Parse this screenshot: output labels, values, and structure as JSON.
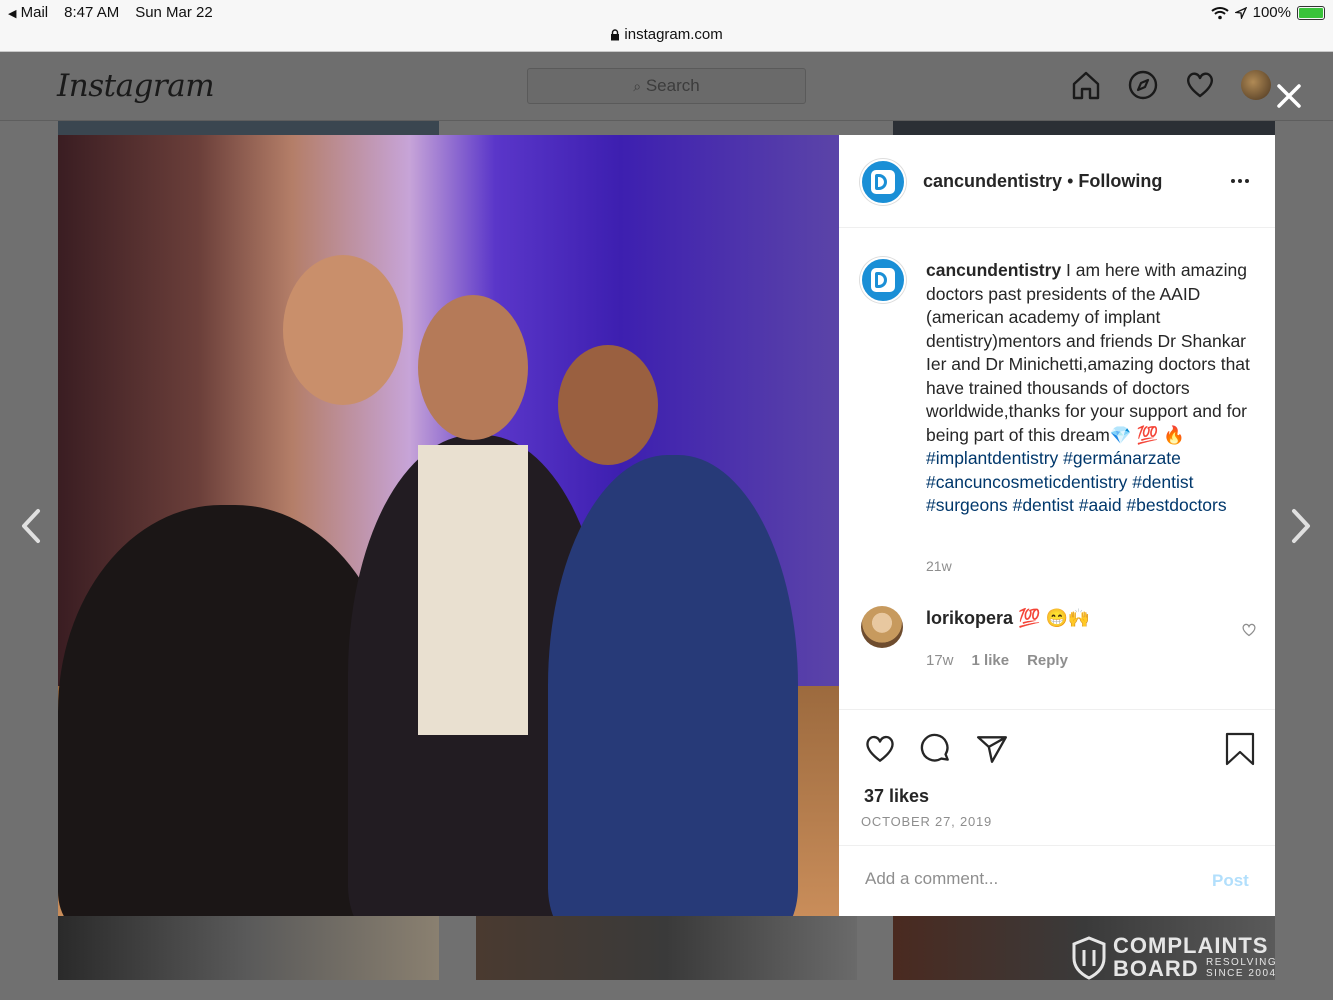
{
  "status_bar": {
    "back_app": "Mail",
    "time": "8:47 AM",
    "date": "Sun Mar 22",
    "battery": "100%"
  },
  "url": "instagram.com",
  "header": {
    "logo": "Instagram",
    "search_placeholder": "Search"
  },
  "post": {
    "username": "cancundentistry",
    "follow_status": "Following",
    "caption_user": "cancundentistry",
    "caption_text": " I am here with amazing doctors past presidents of the AAID (american academy of implant dentistry)mentors and friends Dr Shankar Ier and Dr Minichetti,amazing doctors that have trained thousands of doctors worldwide,thanks for your support and for being part of this dream💎 💯 🔥",
    "caption_tags": "#implantdentistry #germánarzate #cancuncosmeticdentistry #dentist #surgeons #dentist #aaid #bestdoctors",
    "caption_age": "21w",
    "likes": "37 likes",
    "date": "OCTOBER 27, 2019",
    "comment_placeholder": "Add a comment...",
    "post_button": "Post"
  },
  "comment": {
    "username": "lorikopera",
    "text": " 💯 😁🙌",
    "age": "17w",
    "likes": "1 like",
    "reply": "Reply"
  },
  "watermark": {
    "line1": "COMPLAINTS",
    "line2": "BOARD",
    "tag1": "RESOLVING",
    "tag2": "SINCE 2004"
  },
  "colors": {
    "link": "#00376b",
    "meta": "#8e8e8e",
    "post_disabled": "#b2dffc",
    "avatar_brand": "#1a8fd6"
  }
}
